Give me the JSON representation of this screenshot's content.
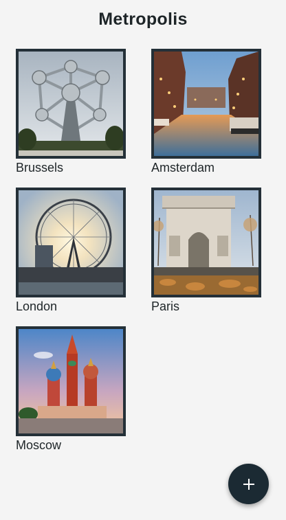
{
  "header": {
    "title": "Metropolis"
  },
  "cities": [
    {
      "label": "Brussels",
      "icon": "atomium-photo"
    },
    {
      "label": "Amsterdam",
      "icon": "canal-photo"
    },
    {
      "label": "London",
      "icon": "london-eye-photo"
    },
    {
      "label": "Paris",
      "icon": "arc-de-triomphe-photo"
    },
    {
      "label": "Moscow",
      "icon": "st-basils-cathedral-photo"
    }
  ],
  "fab": {
    "icon": "plus-icon"
  },
  "colors": {
    "frame": "#243038",
    "fab": "#1b2a33",
    "background": "#f4f4f4"
  }
}
